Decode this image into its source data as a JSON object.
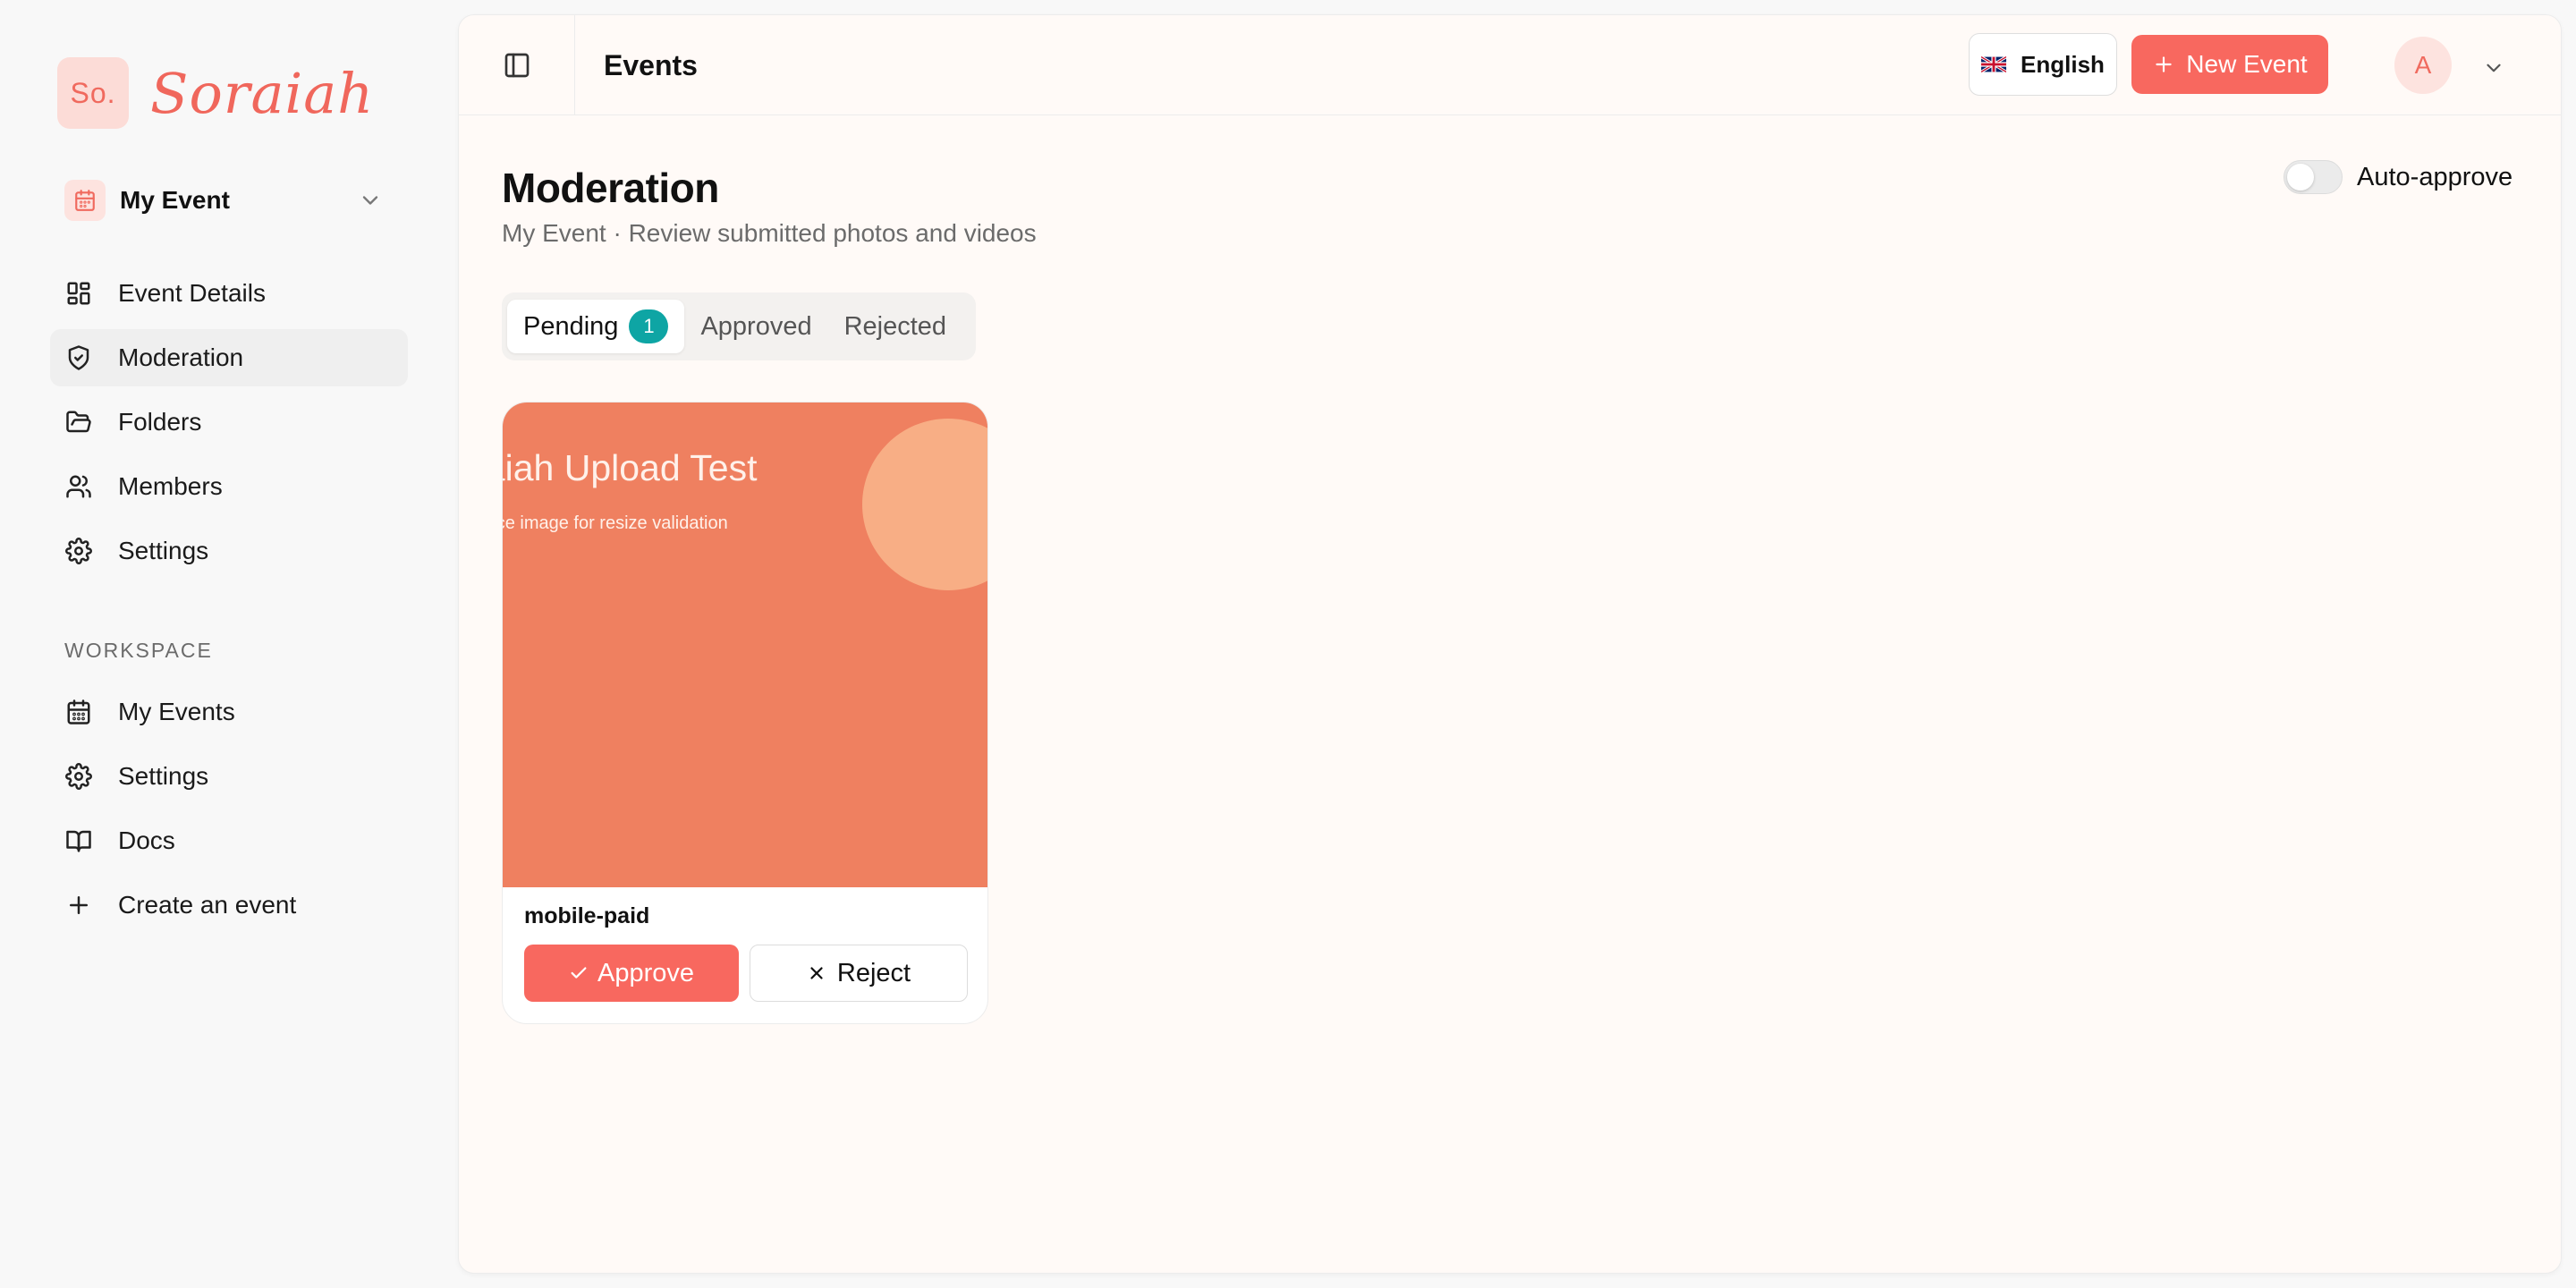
{
  "brand": {
    "mark": "So.",
    "name": "Soraiah"
  },
  "event_selector": {
    "label": "My Event",
    "icon": "calendar-icon"
  },
  "nav_event": [
    {
      "label": "Event Details",
      "icon": "layout-grid-icon",
      "active": false
    },
    {
      "label": "Moderation",
      "icon": "shield-check-icon",
      "active": true
    },
    {
      "label": "Folders",
      "icon": "folder-open-icon",
      "active": false
    },
    {
      "label": "Members",
      "icon": "users-icon",
      "active": false
    },
    {
      "label": "Settings",
      "icon": "gear-icon",
      "active": false
    }
  ],
  "workspace": {
    "section_label": "WORKSPACE",
    "items": [
      {
        "label": "My Events",
        "icon": "calendar-icon"
      },
      {
        "label": "Settings",
        "icon": "gear-icon"
      },
      {
        "label": "Docs",
        "icon": "book-open-icon"
      },
      {
        "label": "Create an event",
        "icon": "plus-icon"
      }
    ]
  },
  "topbar": {
    "title": "Events",
    "language": "English",
    "new_event_label": "New Event",
    "avatar_initial": "A"
  },
  "page": {
    "title": "Moderation",
    "subtitle": "My Event · Review submitted photos and videos",
    "auto_approve_label": "Auto-approve",
    "auto_approve_on": false
  },
  "tabs": [
    {
      "label": "Pending",
      "badge": "1",
      "active": true
    },
    {
      "label": "Approved",
      "active": false
    },
    {
      "label": "Rejected",
      "active": false
    }
  ],
  "submission": {
    "image_title": "Soraiah Upload Test",
    "image_subtitle": "A source image for resize validation",
    "name": "mobile-paid",
    "approve_label": "Approve",
    "reject_label": "Reject"
  },
  "colors": {
    "accent": "#f8685f",
    "badge_teal": "#0ea5a4",
    "thumbnail_bg": "#ef8060"
  }
}
